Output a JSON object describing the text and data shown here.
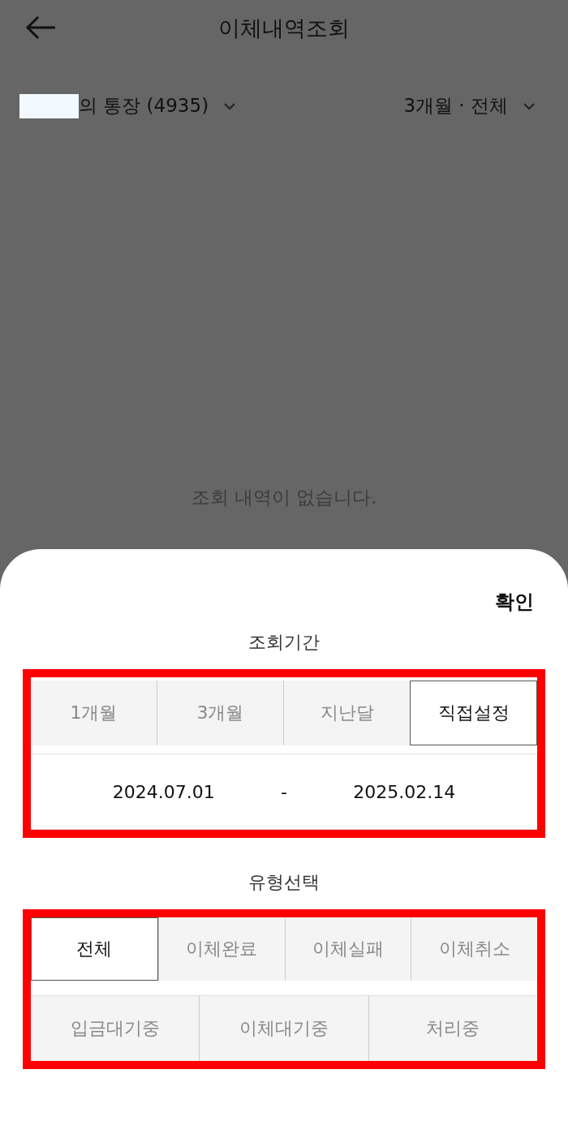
{
  "header": {
    "title": "이체내역조회"
  },
  "account": {
    "redacted": true,
    "label": "의 통장 (4935)"
  },
  "filter_summary": "3개월 · 전체",
  "empty_message": "조회 내역이 없습니다.",
  "sheet": {
    "confirm": "확인",
    "period": {
      "title": "조회기간",
      "highlighted": true,
      "options": [
        {
          "label": "1개월",
          "selected": false
        },
        {
          "label": "3개월",
          "selected": false
        },
        {
          "label": "지난달",
          "selected": false
        },
        {
          "label": "직접설정",
          "selected": true
        }
      ],
      "start_date": "2024.07.01",
      "separator": "-",
      "end_date": "2025.02.14"
    },
    "type": {
      "title": "유형선택",
      "highlighted": true,
      "rows": [
        {
          "options": [
            {
              "label": "전체",
              "selected": true
            },
            {
              "label": "이체완료",
              "selected": false
            },
            {
              "label": "이체실패",
              "selected": false
            },
            {
              "label": "이체취소",
              "selected": false
            }
          ]
        },
        {
          "options": [
            {
              "label": "입금대기중",
              "selected": false
            },
            {
              "label": "이체대기중",
              "selected": false
            },
            {
              "label": "처리중",
              "selected": false
            }
          ]
        }
      ]
    }
  }
}
